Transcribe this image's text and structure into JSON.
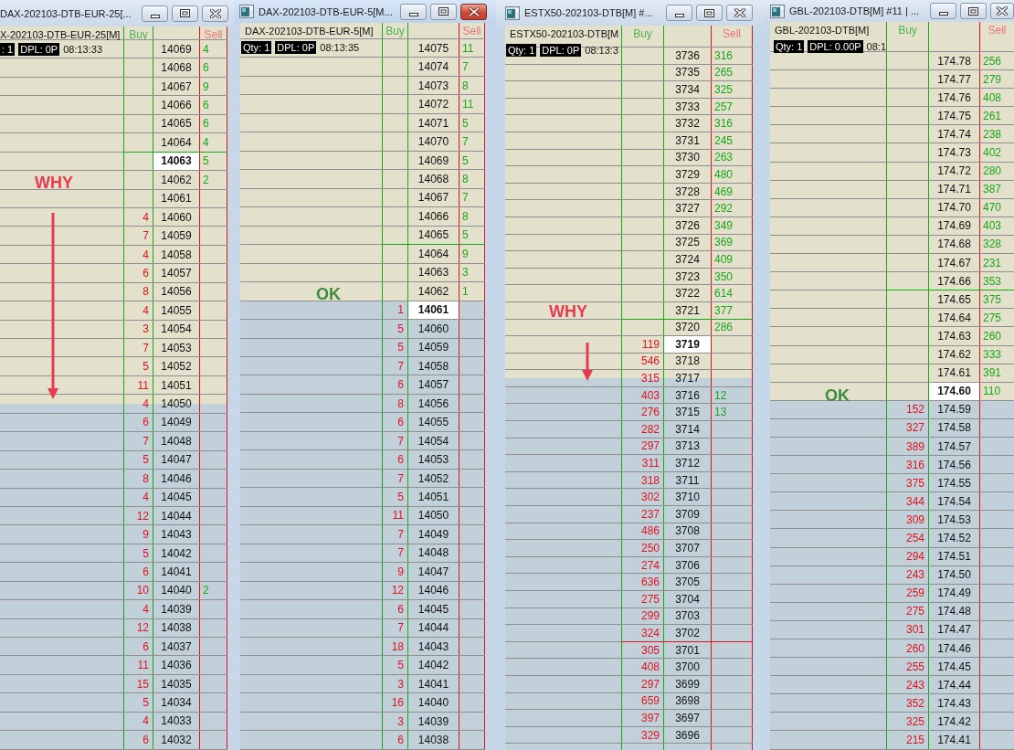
{
  "windows": [
    {
      "title": "DAX-202103-DTB-EUR-25[...",
      "active": false,
      "app_icon": false,
      "instrument": "X-202103-DTB-EUR-25[M]",
      "qty": ": 1",
      "dpl": "DPL: 0P",
      "time": "08:13:33",
      "buy_header": "Buy",
      "sell_header": "Sell",
      "annotations": [
        {
          "kind": "label",
          "text": "WHY",
          "color": "#e8394f"
        },
        {
          "kind": "arrow",
          "color": "#e8394f"
        }
      ],
      "rows": [
        {
          "price": "14069",
          "sell": "4",
          "current": false,
          "kind": "upper"
        },
        {
          "price": "14068",
          "sell": "6",
          "current": false,
          "kind": "upper"
        },
        {
          "price": "14067",
          "sell": "9",
          "current": false,
          "kind": "upper"
        },
        {
          "price": "14066",
          "sell": "6",
          "current": false,
          "kind": "upper"
        },
        {
          "price": "14065",
          "sell": "6",
          "current": false,
          "kind": "upper"
        },
        {
          "price": "14064",
          "sell": "4",
          "current": false,
          "kind": "upper"
        },
        {
          "price": "14063",
          "sell": "5",
          "current": true,
          "kind": "upper",
          "marker_line": {
            "color": "#1aa61a"
          }
        },
        {
          "price": "14062",
          "sell": "2",
          "current": false,
          "kind": "upper"
        },
        {
          "price": "14061",
          "current": false,
          "kind": "upper"
        },
        {
          "price": "14060",
          "buy": "4",
          "current": false,
          "kind": "upper"
        },
        {
          "price": "14059",
          "buy": "7",
          "current": false,
          "kind": "upper"
        },
        {
          "price": "14058",
          "buy": "4",
          "current": false,
          "kind": "upper"
        },
        {
          "price": "14057",
          "buy": "6",
          "current": false,
          "kind": "upper"
        },
        {
          "price": "14056",
          "buy": "8",
          "current": false,
          "kind": "upper"
        },
        {
          "price": "14055",
          "buy": "4",
          "current": false,
          "kind": "upper"
        },
        {
          "price": "14054",
          "buy": "3",
          "current": false,
          "kind": "upper"
        },
        {
          "price": "14053",
          "buy": "7",
          "current": false,
          "kind": "upper"
        },
        {
          "price": "14052",
          "buy": "5",
          "current": false,
          "kind": "upper"
        },
        {
          "price": "14051",
          "buy": "11",
          "current": false,
          "kind": "upper"
        },
        {
          "price": "14050",
          "buy": "4",
          "current": false,
          "kind": "boundary"
        },
        {
          "price": "14049",
          "buy": "6",
          "current": false,
          "kind": "lower"
        },
        {
          "price": "14048",
          "buy": "7",
          "current": false,
          "kind": "lower"
        },
        {
          "price": "14047",
          "buy": "5",
          "current": false,
          "kind": "lower"
        },
        {
          "price": "14046",
          "buy": "8",
          "current": false,
          "kind": "lower"
        },
        {
          "price": "14045",
          "buy": "4",
          "current": false,
          "kind": "lower"
        },
        {
          "price": "14044",
          "buy": "12",
          "current": false,
          "kind": "lower"
        },
        {
          "price": "14043",
          "buy": "9",
          "current": false,
          "kind": "lower"
        },
        {
          "price": "14042",
          "buy": "5",
          "current": false,
          "kind": "lower"
        },
        {
          "price": "14041",
          "buy": "6",
          "current": false,
          "kind": "lower"
        },
        {
          "price": "14040",
          "buy": "10",
          "sell": "2",
          "current": false,
          "kind": "lower"
        },
        {
          "price": "14039",
          "buy": "4",
          "current": false,
          "kind": "lower"
        },
        {
          "price": "14038",
          "buy": "12",
          "current": false,
          "kind": "lower"
        },
        {
          "price": "14037",
          "buy": "6",
          "current": false,
          "kind": "lower"
        },
        {
          "price": "14036",
          "buy": "11",
          "current": false,
          "kind": "lower"
        },
        {
          "price": "14035",
          "buy": "15",
          "current": false,
          "kind": "lower"
        },
        {
          "price": "14034",
          "buy": "5",
          "current": false,
          "kind": "lower"
        },
        {
          "price": "14033",
          "buy": "4",
          "current": false,
          "kind": "lower"
        },
        {
          "price": "14032",
          "buy": "6",
          "current": false,
          "kind": "lower"
        }
      ]
    },
    {
      "title": "DAX-202103-DTB-EUR-5[M...",
      "active": true,
      "app_icon": true,
      "instrument": "DAX-202103-DTB-EUR-5[M]",
      "qty": "Qty: 1",
      "dpl": "DPL: 0P",
      "time": "08:13:35",
      "buy_header": "Buy",
      "sell_header": "Sell",
      "annotations": [
        {
          "kind": "label",
          "text": "OK",
          "color": "#3d8b3d"
        }
      ],
      "rows": [
        {
          "price": "14075",
          "sell": "11",
          "current": false,
          "kind": "upper"
        },
        {
          "price": "14074",
          "sell": "7",
          "current": false,
          "kind": "upper"
        },
        {
          "price": "14073",
          "sell": "8",
          "current": false,
          "kind": "upper"
        },
        {
          "price": "14072",
          "sell": "11",
          "current": false,
          "kind": "upper"
        },
        {
          "price": "14071",
          "sell": "5",
          "current": false,
          "kind": "upper"
        },
        {
          "price": "14070",
          "sell": "7",
          "current": false,
          "kind": "upper"
        },
        {
          "price": "14069",
          "sell": "5",
          "current": false,
          "kind": "upper"
        },
        {
          "price": "14068",
          "sell": "8",
          "current": false,
          "kind": "upper"
        },
        {
          "price": "14067",
          "sell": "7",
          "current": false,
          "kind": "upper"
        },
        {
          "price": "14066",
          "sell": "8",
          "current": false,
          "kind": "upper"
        },
        {
          "price": "14065",
          "sell": "5",
          "current": false,
          "kind": "upper"
        },
        {
          "price": "14064",
          "sell": "9",
          "current": false,
          "kind": "upper",
          "marker_line": {
            "color": "#1aa61a"
          }
        },
        {
          "price": "14063",
          "sell": "3",
          "current": false,
          "kind": "upper"
        },
        {
          "price": "14062",
          "sell": "1",
          "current": false,
          "kind": "upper"
        },
        {
          "price": "14061",
          "buy": "1",
          "current": true,
          "kind": "lower"
        },
        {
          "price": "14060",
          "buy": "5",
          "current": false,
          "kind": "lower"
        },
        {
          "price": "14059",
          "buy": "5",
          "current": false,
          "kind": "lower"
        },
        {
          "price": "14058",
          "buy": "7",
          "current": false,
          "kind": "lower"
        },
        {
          "price": "14057",
          "buy": "6",
          "current": false,
          "kind": "lower"
        },
        {
          "price": "14056",
          "buy": "8",
          "current": false,
          "kind": "lower"
        },
        {
          "price": "14055",
          "buy": "6",
          "current": false,
          "kind": "lower"
        },
        {
          "price": "14054",
          "buy": "7",
          "current": false,
          "kind": "lower"
        },
        {
          "price": "14053",
          "buy": "6",
          "current": false,
          "kind": "lower"
        },
        {
          "price": "14052",
          "buy": "7",
          "current": false,
          "kind": "lower"
        },
        {
          "price": "14051",
          "buy": "5",
          "current": false,
          "kind": "lower"
        },
        {
          "price": "14050",
          "buy": "11",
          "current": false,
          "kind": "lower"
        },
        {
          "price": "14049",
          "buy": "7",
          "current": false,
          "kind": "lower"
        },
        {
          "price": "14048",
          "buy": "7",
          "current": false,
          "kind": "lower"
        },
        {
          "price": "14047",
          "buy": "9",
          "current": false,
          "kind": "lower"
        },
        {
          "price": "14046",
          "buy": "12",
          "current": false,
          "kind": "lower"
        },
        {
          "price": "14045",
          "buy": "6",
          "current": false,
          "kind": "lower"
        },
        {
          "price": "14044",
          "buy": "7",
          "current": false,
          "kind": "lower"
        },
        {
          "price": "14043",
          "buy": "18",
          "current": false,
          "kind": "lower"
        },
        {
          "price": "14042",
          "buy": "5",
          "current": false,
          "kind": "lower"
        },
        {
          "price": "14041",
          "buy": "3",
          "current": false,
          "kind": "lower"
        },
        {
          "price": "14040",
          "buy": "16",
          "current": false,
          "kind": "lower"
        },
        {
          "price": "14039",
          "buy": "3",
          "current": false,
          "kind": "lower"
        },
        {
          "price": "14038",
          "buy": "6",
          "current": false,
          "kind": "lower"
        }
      ]
    },
    {
      "title": "ESTX50-202103-DTB[M] #...",
      "active": false,
      "app_icon": true,
      "instrument": "ESTX50-202103-DTB[M",
      "qty": "Qty: 1",
      "dpl": "DPL: 0P",
      "time": "08:13:3",
      "buy_header": "Buy",
      "sell_header": "Sell",
      "annotations": [
        {
          "kind": "label",
          "text": "WHY",
          "color": "#e8394f"
        },
        {
          "kind": "arrow",
          "color": "#e8394f"
        }
      ],
      "rows": [
        {
          "price": "3736",
          "sell": "316",
          "current": false,
          "kind": "upper"
        },
        {
          "price": "3735",
          "sell": "265",
          "current": false,
          "kind": "upper"
        },
        {
          "price": "3734",
          "sell": "325",
          "current": false,
          "kind": "upper"
        },
        {
          "price": "3733",
          "sell": "257",
          "current": false,
          "kind": "upper"
        },
        {
          "price": "3732",
          "sell": "316",
          "current": false,
          "kind": "upper"
        },
        {
          "price": "3731",
          "sell": "245",
          "current": false,
          "kind": "upper"
        },
        {
          "price": "3730",
          "sell": "263",
          "current": false,
          "kind": "upper"
        },
        {
          "price": "3729",
          "sell": "480",
          "current": false,
          "kind": "upper"
        },
        {
          "price": "3728",
          "sell": "469",
          "current": false,
          "kind": "upper"
        },
        {
          "price": "3727",
          "sell": "292",
          "current": false,
          "kind": "upper"
        },
        {
          "price": "3726",
          "sell": "349",
          "current": false,
          "kind": "upper"
        },
        {
          "price": "3725",
          "sell": "369",
          "current": false,
          "kind": "upper"
        },
        {
          "price": "3724",
          "sell": "409",
          "current": false,
          "kind": "upper"
        },
        {
          "price": "3723",
          "sell": "350",
          "current": false,
          "kind": "upper"
        },
        {
          "price": "3722",
          "sell": "614",
          "current": false,
          "kind": "upper"
        },
        {
          "price": "3721",
          "sell": "377",
          "current": false,
          "kind": "upper"
        },
        {
          "price": "3720",
          "sell": "286",
          "current": false,
          "kind": "upper",
          "marker_line": {
            "color": "#1aa61a"
          }
        },
        {
          "price": "3719",
          "buy": "119",
          "current": true,
          "kind": "upper"
        },
        {
          "price": "3718",
          "buy": "546",
          "current": false,
          "kind": "upper"
        },
        {
          "price": "3717",
          "buy": "315",
          "current": false,
          "kind": "boundary"
        },
        {
          "price": "3716",
          "buy": "403",
          "sell": "12",
          "current": false,
          "kind": "lower"
        },
        {
          "price": "3715",
          "buy": "276",
          "sell": "13",
          "current": false,
          "kind": "lower"
        },
        {
          "price": "3714",
          "buy": "282",
          "current": false,
          "kind": "lower"
        },
        {
          "price": "3713",
          "buy": "297",
          "current": false,
          "kind": "lower"
        },
        {
          "price": "3712",
          "buy": "311",
          "current": false,
          "kind": "lower"
        },
        {
          "price": "3711",
          "buy": "318",
          "current": false,
          "kind": "lower"
        },
        {
          "price": "3710",
          "buy": "302",
          "current": false,
          "kind": "lower"
        },
        {
          "price": "3709",
          "buy": "237",
          "current": false,
          "kind": "lower"
        },
        {
          "price": "3708",
          "buy": "486",
          "current": false,
          "kind": "lower"
        },
        {
          "price": "3707",
          "buy": "250",
          "current": false,
          "kind": "lower"
        },
        {
          "price": "3706",
          "buy": "274",
          "current": false,
          "kind": "lower"
        },
        {
          "price": "3705",
          "buy": "636",
          "current": false,
          "kind": "lower"
        },
        {
          "price": "3704",
          "buy": "275",
          "current": false,
          "kind": "lower"
        },
        {
          "price": "3703",
          "buy": "299",
          "current": false,
          "kind": "lower"
        },
        {
          "price": "3702",
          "buy": "324",
          "current": false,
          "kind": "lower"
        },
        {
          "price": "3701",
          "buy": "305",
          "current": false,
          "kind": "lower",
          "marker_line": {
            "color": "#e2121c"
          }
        },
        {
          "price": "3700",
          "buy": "408",
          "current": false,
          "kind": "lower"
        },
        {
          "price": "3699",
          "buy": "297",
          "current": false,
          "kind": "lower"
        },
        {
          "price": "3698",
          "buy": "659",
          "current": false,
          "kind": "lower"
        },
        {
          "price": "3697",
          "buy": "397",
          "current": false,
          "kind": "lower"
        },
        {
          "price": "3696",
          "buy": "329",
          "current": false,
          "kind": "lower"
        }
      ]
    },
    {
      "title": "GBL-202103-DTB[M] #11 | ...",
      "active": false,
      "app_icon": true,
      "instrument": "GBL-202103-DTB[M]",
      "qty": "Qty: 1",
      "dpl": "DPL: 0.00P",
      "time": "08:1",
      "buy_header": "Buy",
      "sell_header": "Sell",
      "annotations": [
        {
          "kind": "label",
          "text": "OK",
          "color": "#3d8b3d"
        }
      ],
      "rows": [
        {
          "price": "174.78",
          "sell": "256",
          "current": false,
          "kind": "upper"
        },
        {
          "price": "174.77",
          "sell": "279",
          "current": false,
          "kind": "upper"
        },
        {
          "price": "174.76",
          "sell": "408",
          "current": false,
          "kind": "upper"
        },
        {
          "price": "174.75",
          "sell": "261",
          "current": false,
          "kind": "upper"
        },
        {
          "price": "174.74",
          "sell": "238",
          "current": false,
          "kind": "upper"
        },
        {
          "price": "174.73",
          "sell": "402",
          "current": false,
          "kind": "upper"
        },
        {
          "price": "174.72",
          "sell": "280",
          "current": false,
          "kind": "upper"
        },
        {
          "price": "174.71",
          "sell": "387",
          "current": false,
          "kind": "upper"
        },
        {
          "price": "174.70",
          "sell": "470",
          "current": false,
          "kind": "upper"
        },
        {
          "price": "174.69",
          "sell": "403",
          "current": false,
          "kind": "upper"
        },
        {
          "price": "174.68",
          "sell": "328",
          "current": false,
          "kind": "upper"
        },
        {
          "price": "174.67",
          "sell": "231",
          "current": false,
          "kind": "upper"
        },
        {
          "price": "174.66",
          "sell": "353",
          "current": false,
          "kind": "upper"
        },
        {
          "price": "174.65",
          "sell": "375",
          "current": false,
          "kind": "upper",
          "marker_line": {
            "color": "#1aa61a"
          }
        },
        {
          "price": "174.64",
          "sell": "275",
          "current": false,
          "kind": "upper"
        },
        {
          "price": "174.63",
          "sell": "260",
          "current": false,
          "kind": "upper"
        },
        {
          "price": "174.62",
          "sell": "333",
          "current": false,
          "kind": "upper"
        },
        {
          "price": "174.61",
          "sell": "391",
          "current": false,
          "kind": "upper"
        },
        {
          "price": "174.60",
          "sell": "110",
          "current": true,
          "kind": "upper"
        },
        {
          "price": "174.59",
          "buy": "152",
          "current": false,
          "kind": "lower"
        },
        {
          "price": "174.58",
          "buy": "327",
          "current": false,
          "kind": "lower"
        },
        {
          "price": "174.57",
          "buy": "389",
          "current": false,
          "kind": "lower"
        },
        {
          "price": "174.56",
          "buy": "316",
          "current": false,
          "kind": "lower"
        },
        {
          "price": "174.55",
          "buy": "375",
          "current": false,
          "kind": "lower"
        },
        {
          "price": "174.54",
          "buy": "344",
          "current": false,
          "kind": "lower"
        },
        {
          "price": "174.53",
          "buy": "309",
          "current": false,
          "kind": "lower"
        },
        {
          "price": "174.52",
          "buy": "254",
          "current": false,
          "kind": "lower"
        },
        {
          "price": "174.51",
          "buy": "294",
          "current": false,
          "kind": "lower"
        },
        {
          "price": "174.50",
          "buy": "243",
          "current": false,
          "kind": "lower"
        },
        {
          "price": "174.49",
          "buy": "259",
          "current": false,
          "kind": "lower"
        },
        {
          "price": "174.48",
          "buy": "275",
          "current": false,
          "kind": "lower"
        },
        {
          "price": "174.47",
          "buy": "301",
          "current": false,
          "kind": "lower"
        },
        {
          "price": "174.46",
          "buy": "260",
          "current": false,
          "kind": "lower"
        },
        {
          "price": "174.45",
          "buy": "255",
          "current": false,
          "kind": "lower"
        },
        {
          "price": "174.44",
          "buy": "243",
          "current": false,
          "kind": "lower"
        },
        {
          "price": "174.43",
          "buy": "352",
          "current": false,
          "kind": "lower"
        },
        {
          "price": "174.42",
          "buy": "325",
          "current": false,
          "kind": "lower"
        },
        {
          "price": "174.41",
          "buy": "215",
          "current": false,
          "kind": "lower"
        }
      ]
    }
  ]
}
